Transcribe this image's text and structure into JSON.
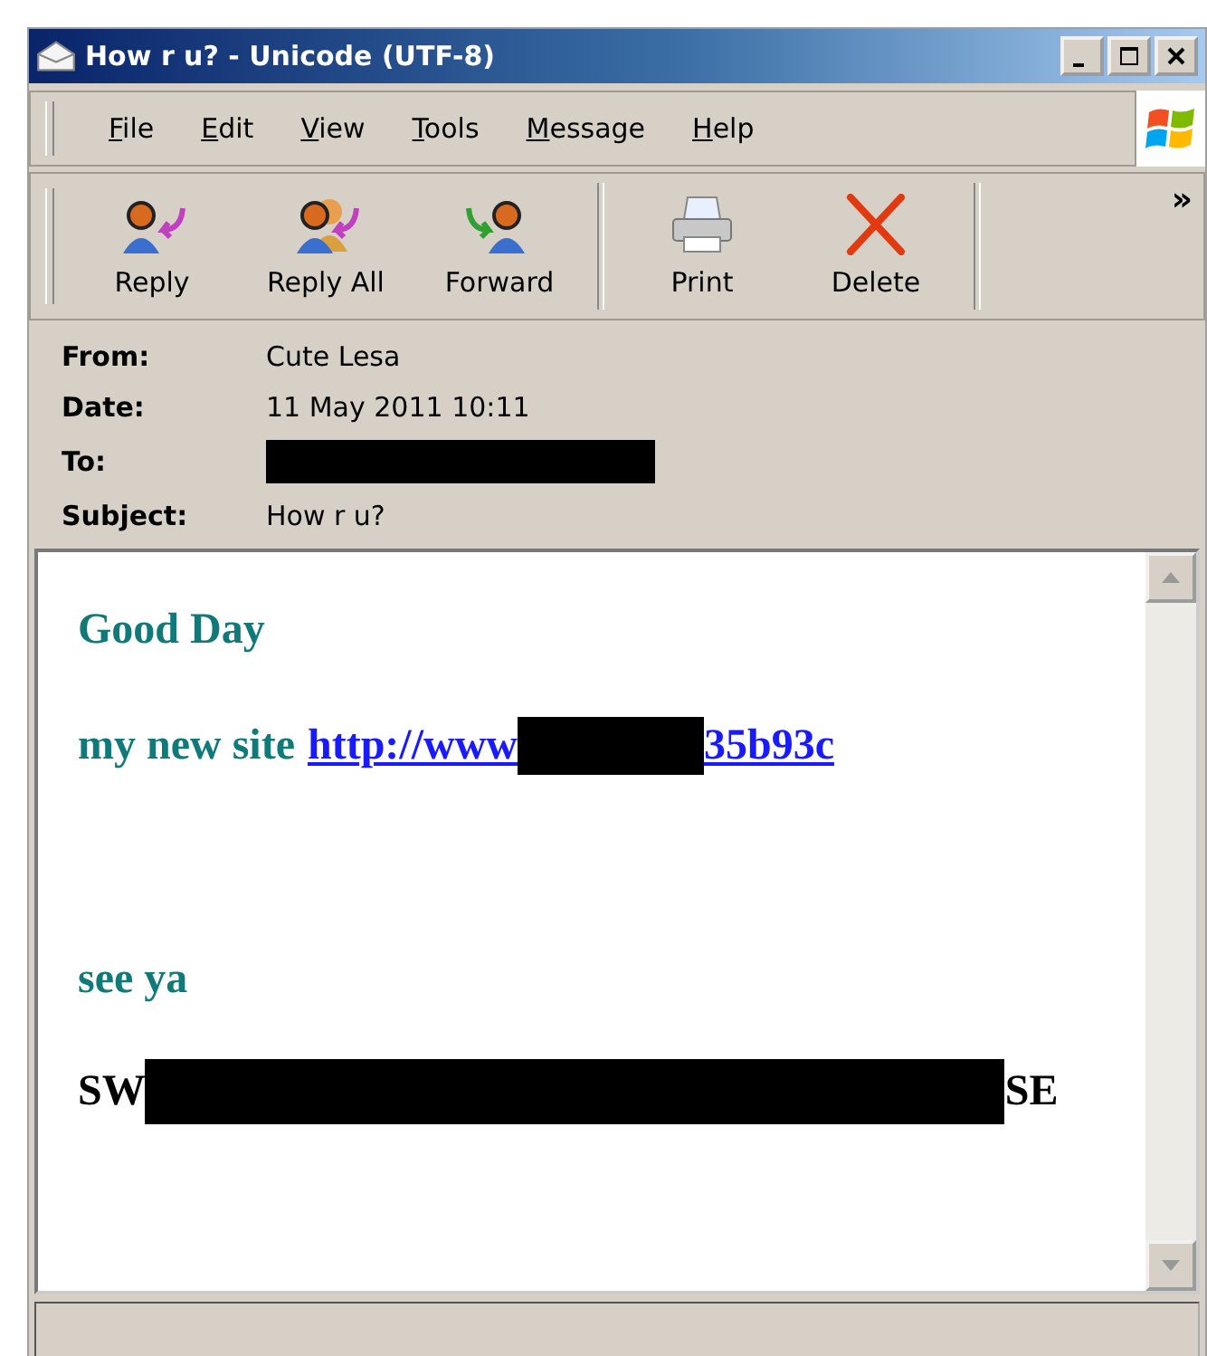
{
  "window": {
    "title": "How r u? - Unicode (UTF-8)"
  },
  "menu": [
    "File",
    "Edit",
    "View",
    "Tools",
    "Message",
    "Help"
  ],
  "toolbar": [
    {
      "label": "Reply",
      "kind": "reply"
    },
    {
      "label": "Reply All",
      "kind": "replyall"
    },
    {
      "label": "Forward",
      "kind": "forward"
    },
    {
      "label": "Print",
      "kind": "print"
    },
    {
      "label": "Delete",
      "kind": "delete"
    }
  ],
  "chevron": "»",
  "headers": [
    {
      "label": "From:",
      "value": "Cute Lesa",
      "redacted": false
    },
    {
      "label": "Date:",
      "value": "11 May 2011 10:11",
      "redacted": false
    },
    {
      "label": "To:",
      "redacted": true
    },
    {
      "label": "Subject:",
      "value": "How r u?",
      "redacted": false
    }
  ],
  "body": {
    "greeting": "Good Day",
    "site_label": "my new site",
    "link_start": "http://www",
    "link_end": "35b93c",
    "closing": "see ya",
    "signature_start": "SW",
    "signature_end": "SE"
  }
}
